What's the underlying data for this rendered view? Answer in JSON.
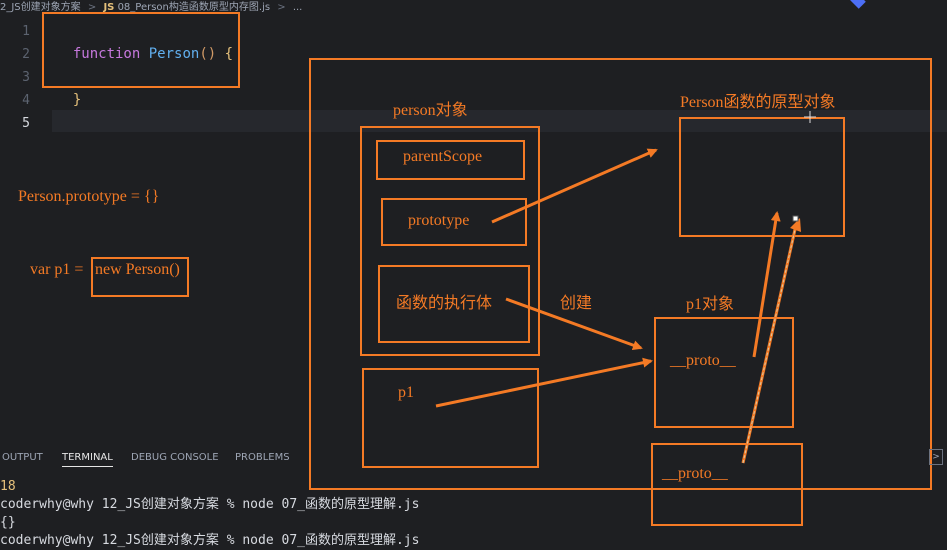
{
  "breadcrumb": {
    "folder": "2_JS创建对象方案",
    "sep1": ">",
    "file_icon": "JS",
    "file": "08_Person构造函数原型内存图.js",
    "sep2": ">",
    "more": "..."
  },
  "editor": {
    "line_numbers": [
      "1",
      "2",
      "3",
      "4",
      "5"
    ],
    "line1": {
      "keyword": "function",
      "name": "Person",
      "parens": "()",
      "brace": "{"
    },
    "line3": {
      "brace": "}"
    }
  },
  "annotations": {
    "prototype_assign": "Person.prototype = {}",
    "var_p1": "var p1 = ",
    "new_person": "new Person()",
    "person_object_title": "person对象",
    "parent_scope": "parentScope",
    "prototype": "prototype",
    "function_body": "函数的执行体",
    "create_label": "创建",
    "p1_var": "p1",
    "prototype_object_title": "Person函数的原型对象",
    "p1_object_title": "p1对象",
    "proto_in_p1": "__proto__",
    "proto_extra": "__proto__"
  },
  "panel": {
    "tabs": [
      "OUTPUT",
      "TERMINAL",
      "DEBUG CONSOLE",
      "PROBLEMS"
    ],
    "active_tab": "TERMINAL"
  },
  "terminal": {
    "lines": [
      "18",
      "coderwhy@why 12_JS创建对象方案 % node 07_函数的原型理解.js",
      "{}",
      "coderwhy@why 12_JS创建对象方案 % node 07_函数的原型理解.js"
    ]
  },
  "colors": {
    "annotation": "#f47a25",
    "background": "#1e1f22",
    "keyword": "#c678dd",
    "function_name": "#61afef",
    "terminal_number": "#e5c07b"
  }
}
